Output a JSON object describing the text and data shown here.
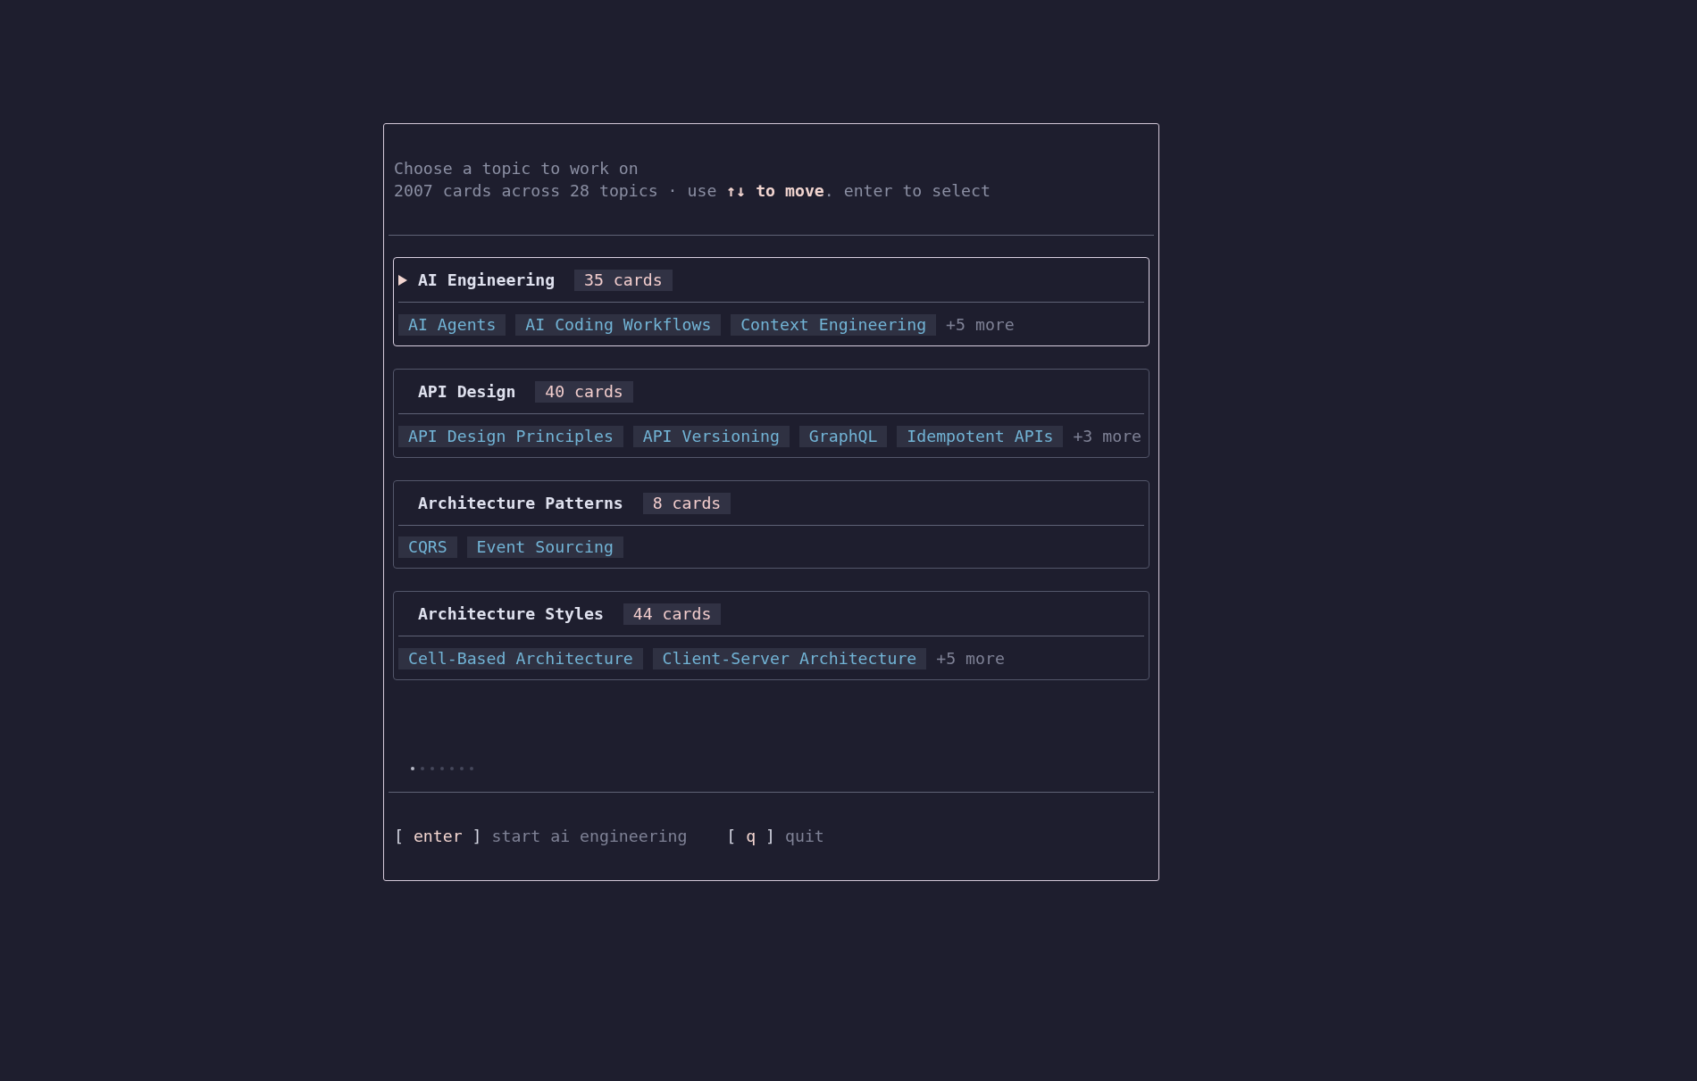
{
  "header": {
    "title": "Choose a topic to work on",
    "subtitle": "2007 cards across 28 topics · use **↑↓ to move**. enter to select"
  },
  "topics": [
    {
      "name": "AI Engineering",
      "count": "35 cards",
      "selected": true,
      "tags": [
        "AI Agents",
        "AI Coding Workflows",
        "Context Engineering"
      ],
      "more": "+5 more"
    },
    {
      "name": "API Design",
      "count": "40 cards",
      "selected": false,
      "tags": [
        "API Design Principles",
        "API Versioning",
        "GraphQL",
        "Idempotent APIs"
      ],
      "more": "+3 more"
    },
    {
      "name": "Architecture Patterns",
      "count": "8 cards",
      "selected": false,
      "tags": [
        "CQRS",
        "Event Sourcing"
      ]
    },
    {
      "name": "Architecture Styles",
      "count": "44 cards",
      "selected": false,
      "tags": [
        "Cell-Based Architecture",
        "Client-Server Architecture"
      ],
      "more": "+5 more"
    }
  ],
  "pages": [
    {
      "selected": true
    },
    {
      "selected": false
    },
    {
      "selected": false
    },
    {
      "selected": false
    },
    {
      "selected": false
    },
    {
      "selected": false
    },
    {
      "selected": false
    }
  ],
  "footer": {
    "hints": [
      {
        "key": "[ **enter** ]",
        "action": "start ai engineering"
      },
      {
        "key": "[ **q** ]",
        "action": "quit"
      }
    ]
  }
}
